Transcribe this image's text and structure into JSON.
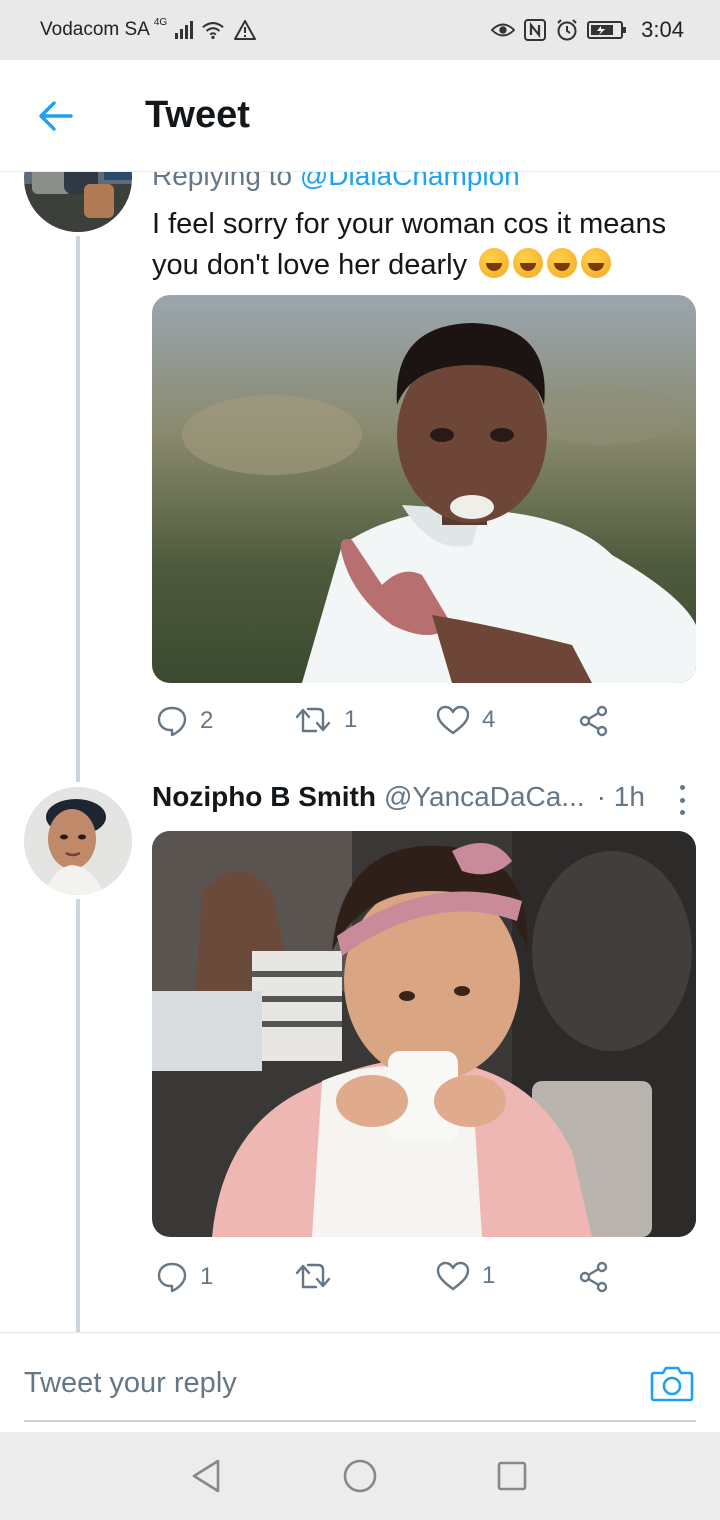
{
  "status_bar": {
    "carrier": "Vodacom SA",
    "network": "4G",
    "time": "3:04",
    "icons": [
      "signal-icon",
      "wifi-icon",
      "warning-icon",
      "eye-icon",
      "nfc-icon",
      "alarm-icon",
      "battery-icon"
    ]
  },
  "header": {
    "title": "Tweet",
    "back_icon": "back-arrow-icon"
  },
  "colors": {
    "accent": "#1da1f2",
    "text": "#14171a",
    "muted": "#657786",
    "thread_line": "#ccd6dd"
  },
  "tweets": [
    {
      "replying_to_label": "Replying to",
      "replying_to_handle": "@DialaChampion",
      "text": "I feel sorry for your woman cos it means you don't love her dearly",
      "emoji": [
        "rolling-on-floor-laughing",
        "rolling-on-floor-laughing",
        "rolling-on-floor-laughing",
        "rolling-on-floor-laughing"
      ],
      "actions": {
        "replies": "2",
        "retweets": "1",
        "likes": "4"
      }
    },
    {
      "author_name": "Nozipho B Smith",
      "author_handle": "@YancaDaCa...",
      "time": "· 1h",
      "actions": {
        "replies": "1",
        "retweets": "",
        "likes": "1"
      }
    }
  ],
  "reply_bar": {
    "placeholder": "Tweet your reply",
    "camera_icon": "camera-icon"
  },
  "nav_bar": {
    "icons": [
      "back-triangle-icon",
      "home-circle-icon",
      "recents-square-icon"
    ]
  }
}
